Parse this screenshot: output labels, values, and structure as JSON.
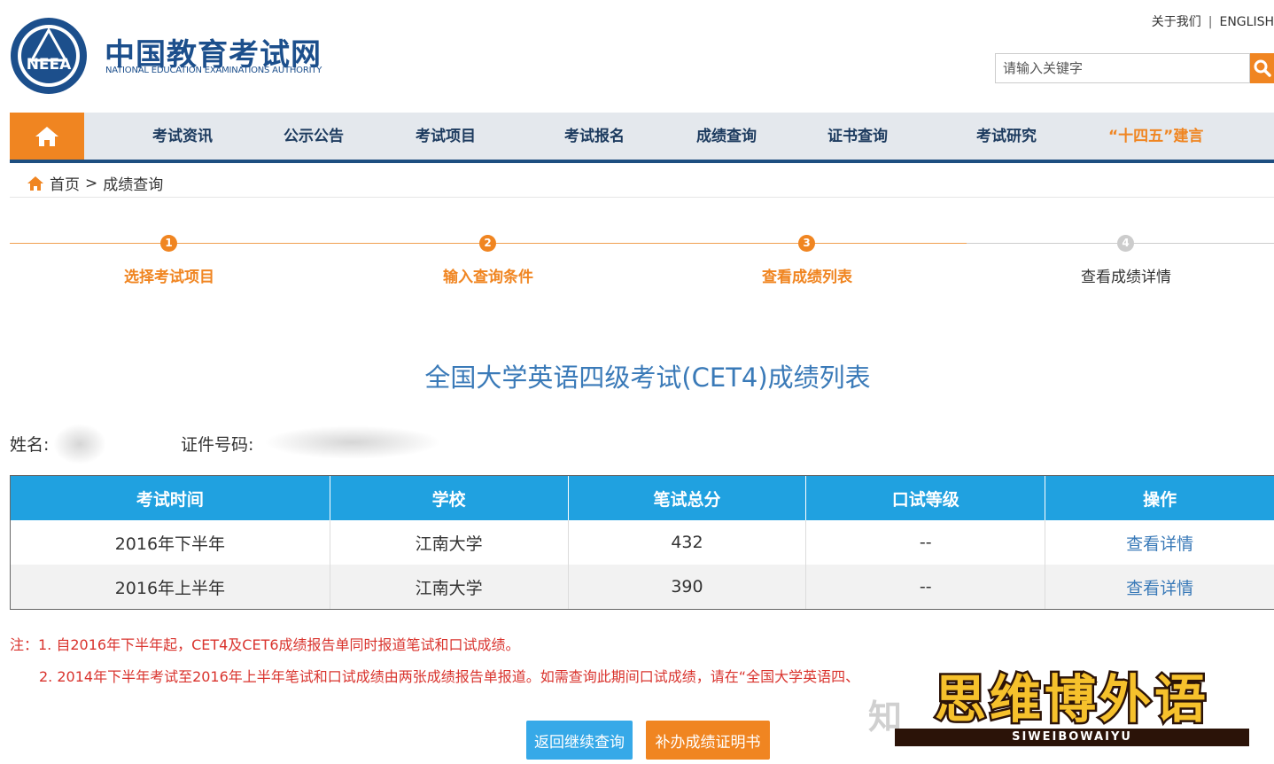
{
  "header": {
    "logo_title": "中国教育考试网",
    "logo_subtitle": "NATIONAL EDUCATION EXAMINATIONS AUTHORITY",
    "logo_emblem_text": "NEEA",
    "about_link": "关于我们",
    "separator": "|",
    "english_link": "ENGLISH",
    "search_placeholder": "请输入关键字"
  },
  "nav": {
    "items": [
      "考试资讯",
      "公示公告",
      "考试项目",
      "考试报名",
      "成绩查询",
      "证书查询",
      "考试研究",
      "“十四五”建言"
    ]
  },
  "breadcrumb": {
    "home": "首页",
    "separator": ">",
    "current": "成绩查询"
  },
  "steps": [
    {
      "num": "1",
      "label": "选择考试项目"
    },
    {
      "num": "2",
      "label": "输入查询条件"
    },
    {
      "num": "3",
      "label": "查看成绩列表"
    },
    {
      "num": "4",
      "label": "查看成绩详情"
    }
  ],
  "title": "全国大学英语四级考试(CET4)成绩列表",
  "info": {
    "name_label": "姓名:",
    "id_label": "证件号码:"
  },
  "table": {
    "headers": [
      "考试时间",
      "学校",
      "笔试总分",
      "口试等级",
      "操作"
    ],
    "rows": [
      [
        "2016年下半年",
        "江南大学",
        "432",
        "--",
        "查看详情"
      ],
      [
        "2016年上半年",
        "江南大学",
        "390",
        "--",
        "查看详情"
      ]
    ]
  },
  "notes": {
    "note1": "注：1. 自2016年下半年起，CET4及CET6成绩报告单同时报道笔试和口试成绩。",
    "note2": "2. 2014年下半年考试至2016年上半年笔试和口试成绩由两张成绩报告单报道。如需查询此期间口试成绩，请在“全国大学英语四、"
  },
  "buttons": {
    "back": "返回继续查询",
    "certificate": "补办成绩证明书"
  },
  "watermark": {
    "zhi": "知",
    "main": "思维博外语",
    "sub": "SIWEIBOWAIYU"
  },
  "colors": {
    "brand_blue": "#1d4e80",
    "accent_orange": "#f08521",
    "table_header": "#20a1e0",
    "note_red": "#d9332d"
  }
}
